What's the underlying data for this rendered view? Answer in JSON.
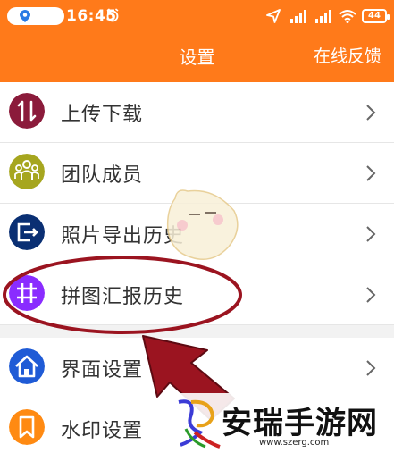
{
  "status_bar": {
    "time": "16:45",
    "battery": "44"
  },
  "header": {
    "title": "设置",
    "action": "在线反馈"
  },
  "menu": [
    {
      "label": "上传下载",
      "icon": "upload-download-icon",
      "color": "#8b1b3b"
    },
    {
      "label": "团队成员",
      "icon": "team-members-icon",
      "color": "#a6a61f"
    },
    {
      "label": "照片导出历史",
      "icon": "photo-export-icon",
      "color": "#0a2f73"
    },
    {
      "label": "拼图汇报历史",
      "icon": "grid-report-icon",
      "color": "#8a2cff"
    },
    {
      "label": "界面设置",
      "icon": "home-layout-icon",
      "color": "#1f5bd6"
    },
    {
      "label": "水印设置",
      "icon": "bookmark-icon",
      "color": "#ff8a12"
    }
  ],
  "watermark": {
    "name": "安瑞手游网",
    "url": "www.szerg.com"
  },
  "colors": {
    "header": "#ff7a1a",
    "annotation": "#9b1420"
  }
}
